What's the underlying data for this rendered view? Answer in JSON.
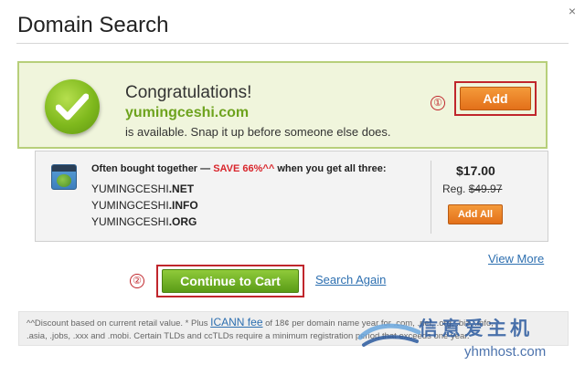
{
  "dialog": {
    "title": "Domain Search",
    "close_icon": "×"
  },
  "success": {
    "heading": "Congratulations!",
    "domain": "yumingceshi.com",
    "message": "is available. Snap it up before someone else does.",
    "step_marker": "①",
    "add_label": "Add",
    "icon": "checkmark-icon"
  },
  "bundle": {
    "icon": "globe-icon",
    "lead": "Often bought together — ",
    "save": "SAVE 66%^^",
    "trail": " when you get all three:",
    "items": [
      {
        "base": "YUMINGCESHI",
        "tld": ".NET"
      },
      {
        "base": "YUMINGCESHI",
        "tld": ".INFO"
      },
      {
        "base": "YUMINGCESHI",
        "tld": ".ORG"
      }
    ],
    "price": "$17.00",
    "reg_label": "Reg.",
    "reg_price": "$49.97",
    "add_all_label": "Add All"
  },
  "links": {
    "view_more": "View More",
    "search_again": "Search Again"
  },
  "checkout": {
    "step_marker": "②",
    "continue_label": "Continue to Cart"
  },
  "footer": {
    "line1_a": "^^Discount based on current retail value. * Plus ",
    "icann": "ICANN fee",
    "line1_b": " of 18¢ per domain name year for .com, .net, .org, .biz, .info,",
    "line2": ".asia, .jobs, .xxx and .mobi. Certain TLDs and ccTLDs require a minimum registration period that exceeds one year."
  },
  "watermark": {
    "cn": "信意爱主机",
    "url": "yhmhost.com"
  },
  "colors": {
    "success_bg": "#f0f5dc",
    "success_border": "#b7cf7a",
    "orange": "#e3701a",
    "green": "#5a9c17",
    "link": "#2d6fb0",
    "highlight_red": "#c0262c"
  }
}
